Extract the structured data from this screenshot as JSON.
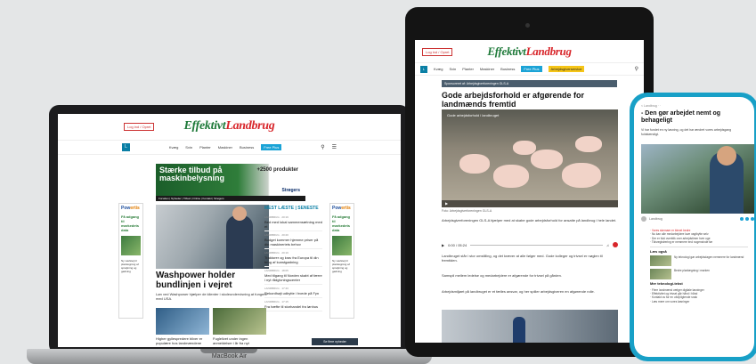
{
  "laptop": {
    "model": "MacBook Air",
    "login_label": "Log ind / Opret",
    "brand": {
      "part1": "Effektivt",
      "part2": "Landbrug"
    },
    "nav": {
      "square": "L",
      "items": [
        "Kvæg",
        "Svin",
        "Planter",
        "Maskiner",
        "Business"
      ],
      "pill": "Free Plus"
    },
    "ad_banner": {
      "line1": "Stærke tilbud på",
      "line2": "maskinbelysning",
      "badge": "+2500 produkter",
      "sponsor": "Strøgers",
      "sub": "Forsiden | Nyheder | Tilbud | Online | Kontakt | Strøgers"
    },
    "side_ad": {
      "brand_a": "Pow",
      "brand_b": "ertis",
      "text": "Få adgang til markedets data",
      "sub": "Ny værktøj til planlægning af sprøjtning og gødning"
    },
    "headline": "Washpower holder bundlinjen i vejret",
    "teaser": "Løn ved Washpower hjælper de klienter i skoleundervisning at fungere med USA.",
    "most_read": {
      "title": "MEST LÆSTE | SENESTE",
      "items": [
        {
          "meta": "LANDBRUG · 20:19",
          "text": "Bed med lokal sammensætning med et"
        },
        {
          "meta": "LANDBRUG · 20:20",
          "text": "Budget kommer hjemme priser på din maskineriets behov"
        },
        {
          "meta": "LANDBRUG · 20:19",
          "text": "Traktorer og krav fra Europa til din brug af kunstgødning"
        },
        {
          "meta": "LANDBRUG · 18:05",
          "text": "Med tilgang til Norden skabt af færre i nyt rådgivningscenter"
        },
        {
          "meta": "LANDBRUG · 17:43",
          "text": "Rekordhøjt udbytte i hvede på Fyn"
        },
        {
          "meta": "LANDBRUG · 17:15",
          "text": "Fra hæfte til storhandel fra lønhus"
        }
      ]
    },
    "bottom_texts": [
      "Higher gyllespredere bliver er populære hos landmændene",
      "Fuglelivet under ingen anmeldelser i år fra nyt"
    ],
    "dark_button": "Se flere nyheder"
  },
  "tablet": {
    "login_label": "Log ind / Opret",
    "brand": {
      "part1": "Effektivt",
      "part2": "Landbrug"
    },
    "nav": {
      "square": "L",
      "items": [
        "Kvæg",
        "Svin",
        "Planter",
        "Maskiner",
        "Business"
      ],
      "pill_blue": "Free Plus",
      "pill_yellow": "Arbejdsgiverservice"
    },
    "sponsor_bar": "Sponsoreret af: Arbejdsgiverforeningen GLS-A",
    "headline": "Gode arbejdsforhold er afgørende for landmænds fremtid",
    "video_meta": "Gode arbejdsforhold i landbruget",
    "caption": "Foto: Arbejdsgiverforeningen GLS-A",
    "para1": "Arbejdsgiverforeningen GLS-A hjælper med at skabe gode arbejdsforhold for ansatte på landbrug i hele landet.",
    "para2": "Landbruget står i stor omstilling, og det kræver at alle følger med. Gode kolleger og trivsel er nøglen til fremtiden.",
    "para3": "Samspil mellem ledelse og medarbejdere er afgørende for trivsel på gården.",
    "para4": "Arbejdsmiljøet på landbruget er et fælles ansvar, og her spiller arbejdsgiveren en afgørende rolle.",
    "audio_time": "0:00 / 05:24"
  },
  "phone": {
    "crumb": "< Landbrug · ·",
    "title": "- Den gør arbejdet nemt og behageligt",
    "lead": "Vi har fundet en ny løsning, og det har ændret vores arbejdsgang fuldstændigt.",
    "byline": "Landbrug",
    "list1": [
      "· Vores skemaer er blevet bedre",
      "· Nu kan alle medarbejdere lave vagtbytte selv",
      "· Der er fuld overblik over arbejdstimer hver uge",
      "· Tidsregistrering er nemmere end nogensinde før"
    ],
    "section1": "Læs også",
    "thumb1_text": "Ny teknologi gør arbejdsdagen nemmere for landmænd",
    "thumb2_text": "Bedre planlægning i marken",
    "section2": "Mer teknologi-tekst",
    "list2": [
      "· Flere landmænd vælger digitale løsninger",
      "· Effektivitet og trivsel går hånd i hånd",
      "· Kontakt os for en uforpligtende snak",
      "· Læs mere om vores løsninger"
    ]
  }
}
